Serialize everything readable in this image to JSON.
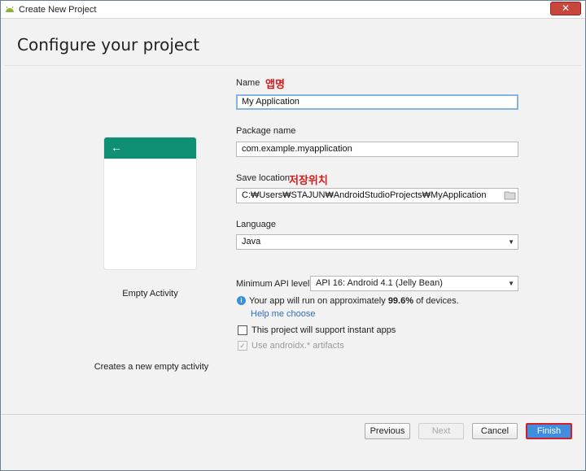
{
  "window": {
    "title": "Create New Project",
    "close_label": "✕"
  },
  "header": {
    "page_title": "Configure your project"
  },
  "template": {
    "name": "Empty Activity",
    "description": "Creates a new empty activity"
  },
  "form": {
    "name": {
      "label": "Name",
      "annotation": "앱명",
      "value": "My Application"
    },
    "package": {
      "label": "Package name",
      "value": "com.example.myapplication"
    },
    "save_location": {
      "label": "Save location",
      "annotation": "저장위치",
      "value": "C:₩Users₩STAJUN₩AndroidStudioProjects₩MyApplication"
    },
    "language": {
      "label": "Language",
      "value": "Java"
    },
    "min_api": {
      "label": "Minimum API level",
      "value": "API 16: Android 4.1 (Jelly Bean)"
    },
    "info": {
      "prefix": "Your app will run on approximately ",
      "percent": "99.6%",
      "suffix": " of devices."
    },
    "help_link": "Help me choose",
    "instant_apps": {
      "label": "This project will support instant apps",
      "checked": false
    },
    "androidx": {
      "label": "Use androidx.* artifacts",
      "checked": true,
      "disabled": true
    }
  },
  "footer": {
    "previous": "Previous",
    "next": "Next",
    "cancel": "Cancel",
    "finish": "Finish"
  },
  "colors": {
    "accent": "#0f8f73",
    "link": "#2f6fbd",
    "annotation": "#d51a1a",
    "finish": "#3f8ee0"
  },
  "icons": [
    "android-icon",
    "close-icon",
    "back-arrow-icon",
    "folder-icon",
    "chevron-down-icon",
    "info-icon",
    "checkbox-icon"
  ]
}
